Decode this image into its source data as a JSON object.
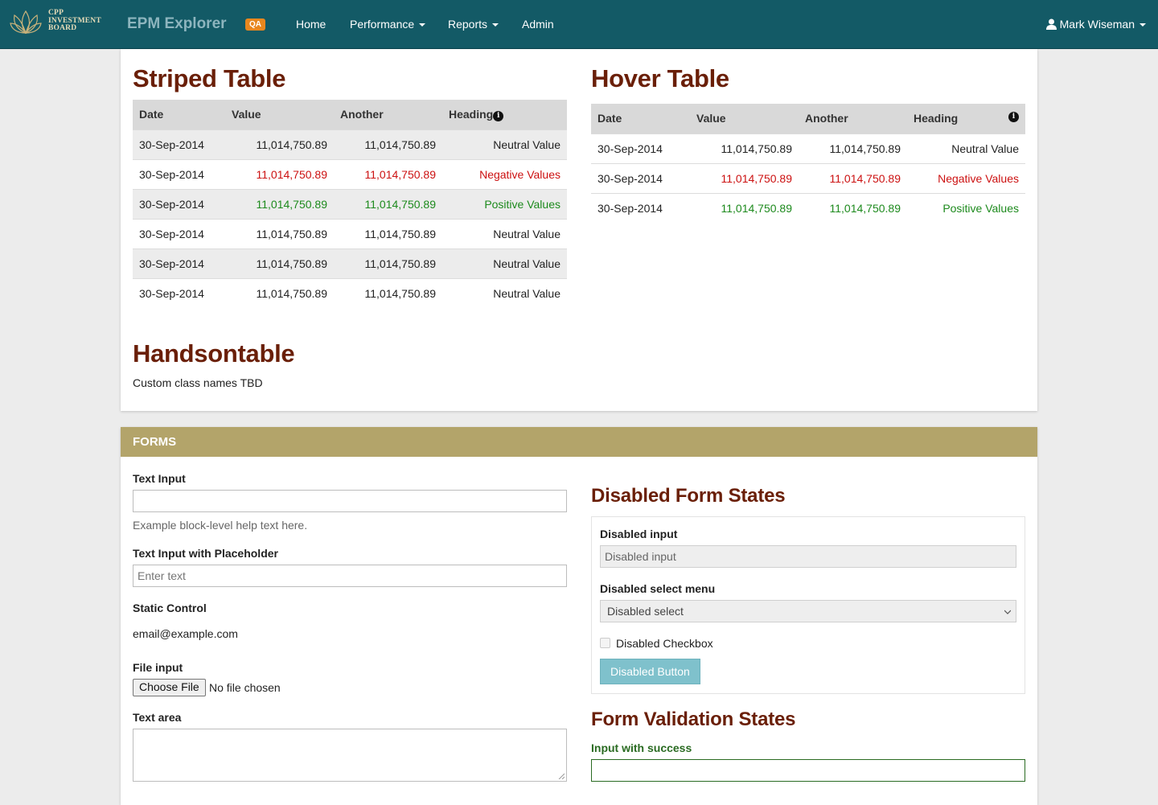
{
  "navbar": {
    "logo_lines": [
      "CPP",
      "INVESTMENT",
      "BOARD"
    ],
    "brand": "EPM Explorer",
    "env_badge": "QA",
    "items": [
      {
        "label": "Home",
        "dropdown": false
      },
      {
        "label": "Performance",
        "dropdown": true
      },
      {
        "label": "Reports",
        "dropdown": true
      },
      {
        "label": "Admin",
        "dropdown": false
      }
    ],
    "user": "Mark Wiseman"
  },
  "striped_table": {
    "title": "Striped Table",
    "headers": [
      "Date",
      "Value",
      "Another",
      "Heading"
    ],
    "rows": [
      {
        "date": "30-Sep-2014",
        "value": "11,014,750.89",
        "another": "11,014,750.89",
        "label": "Neutral Value",
        "status": "neutral"
      },
      {
        "date": "30-Sep-2014",
        "value": "11,014,750.89",
        "another": "11,014,750.89",
        "label": "Negative Values",
        "status": "negative"
      },
      {
        "date": "30-Sep-2014",
        "value": "11,014,750.89",
        "another": "11,014,750.89",
        "label": "Positive Values",
        "status": "positive"
      },
      {
        "date": "30-Sep-2014",
        "value": "11,014,750.89",
        "another": "11,014,750.89",
        "label": "Neutral Value",
        "status": "neutral"
      },
      {
        "date": "30-Sep-2014",
        "value": "11,014,750.89",
        "another": "11,014,750.89",
        "label": "Neutral Value",
        "status": "neutral"
      },
      {
        "date": "30-Sep-2014",
        "value": "11,014,750.89",
        "another": "11,014,750.89",
        "label": "Neutral Value",
        "status": "neutral"
      }
    ]
  },
  "hover_table": {
    "title": "Hover Table",
    "headers": [
      "Date",
      "Value",
      "Another",
      "Heading"
    ],
    "rows": [
      {
        "date": "30-Sep-2014",
        "value": "11,014,750.89",
        "another": "11,014,750.89",
        "label": "Neutral Value",
        "status": "neutral"
      },
      {
        "date": "30-Sep-2014",
        "value": "11,014,750.89",
        "another": "11,014,750.89",
        "label": "Negative Values",
        "status": "negative"
      },
      {
        "date": "30-Sep-2014",
        "value": "11,014,750.89",
        "another": "11,014,750.89",
        "label": "Positive Values",
        "status": "positive"
      }
    ]
  },
  "handsontable": {
    "title": "Handsontable",
    "text": "Custom class names TBD"
  },
  "forms": {
    "heading": "FORMS",
    "text_input": {
      "label": "Text Input",
      "value": "",
      "help": "Example block-level help text here."
    },
    "placeholder_input": {
      "label": "Text Input with Placeholder",
      "placeholder": "Enter text"
    },
    "static_control": {
      "label": "Static Control",
      "value": "email@example.com"
    },
    "file_input": {
      "label": "File input",
      "button": "Choose File",
      "status": "No file chosen"
    },
    "textarea": {
      "label": "Text area",
      "value": ""
    }
  },
  "disabled_states": {
    "title": "Disabled Form States",
    "input_label": "Disabled input",
    "input_placeholder": "Disabled input",
    "select_label": "Disabled select menu",
    "select_value": "Disabled select",
    "checkbox_label": "Disabled Checkbox",
    "button_label": "Disabled Button"
  },
  "validation_states": {
    "title": "Form Validation States",
    "success_label": "Input with success",
    "success_value": ""
  },
  "colors": {
    "navbar": "#135a66",
    "heading": "#6a1f08",
    "forms_header": "#b3a46a",
    "negative": "#cc1111",
    "positive": "#1d8a1d",
    "badge": "#e8871e",
    "disabled_button": "#7fc1cc"
  }
}
